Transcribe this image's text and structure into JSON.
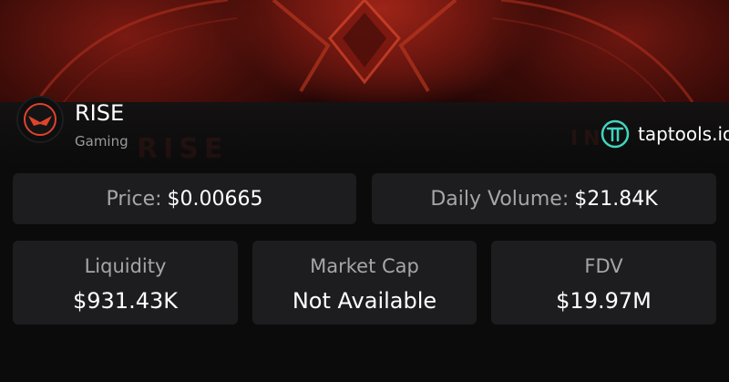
{
  "token": {
    "name": "RISE",
    "category": "Gaming"
  },
  "brand": {
    "name": "taptools.io"
  },
  "stats": {
    "price": {
      "label": "Price:",
      "value": "$0.00665"
    },
    "daily_volume": {
      "label": "Daily Volume:",
      "value": "$21.84K"
    },
    "liquidity": {
      "label": "Liquidity",
      "value": "$931.43K"
    },
    "market_cap": {
      "label": "Market Cap",
      "value": "Not Available"
    },
    "fdv": {
      "label": "FDV",
      "value": "$19.97M"
    }
  },
  "colors": {
    "background": "#0b0b0c",
    "card": "#1d1d1f",
    "label": "#a6a6a6",
    "accent_red": "#e0432b",
    "brand_teal": "#3fd6c0"
  },
  "icons": {
    "token_logo": "rise-bird-logo-icon",
    "brand_logo": "taptools-logo-icon"
  }
}
